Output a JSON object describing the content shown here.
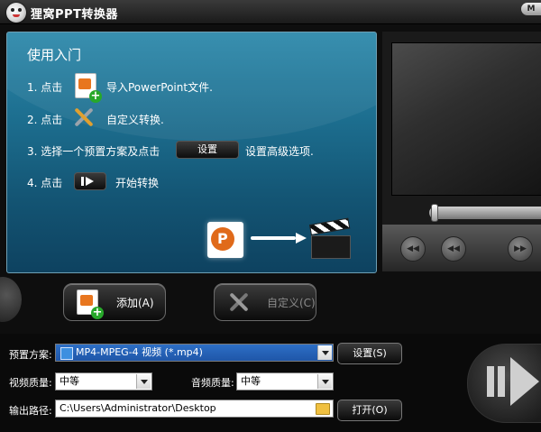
{
  "window": {
    "title": "狸窝PPT转换器",
    "menu_button": "M"
  },
  "guide": {
    "title": "使用入门",
    "step1": {
      "num": "1. 点击",
      "text": "导入PowerPoint文件."
    },
    "step2": {
      "num": "2. 点击",
      "text": "自定义转换."
    },
    "step3": {
      "num": "3. 选择一个预置方案及点击",
      "chip": "设置",
      "text": "设置高级选项."
    },
    "step4": {
      "num": "4. 点击",
      "text": "开始转换"
    }
  },
  "player": {
    "seek": 0.02
  },
  "actions": {
    "add": "添加(A)",
    "customize": "自定义(C)"
  },
  "settings": {
    "preset_label": "预置方案:",
    "preset_value": "MP4-MPEG-4 视频 (*.mp4)",
    "settings_button": "设置(S)",
    "video_quality_label": "视频质量:",
    "video_quality_value": "中等",
    "audio_quality_label": "音频质量:",
    "audio_quality_value": "中等",
    "output_label": "输出路径:",
    "output_path": "C:\\Users\\Administrator\\Desktop",
    "open_button": "打开(O)"
  }
}
